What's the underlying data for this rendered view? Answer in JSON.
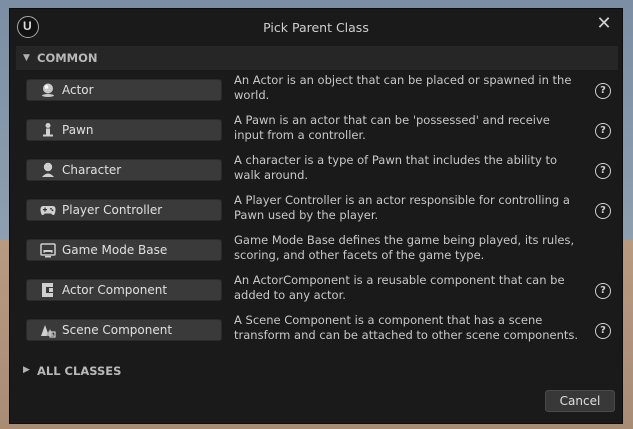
{
  "dialog": {
    "title": "Pick Parent Class",
    "close_icon": "close-icon"
  },
  "common": {
    "header": "COMMON",
    "items": [
      {
        "label": "Actor",
        "icon": "actor-icon",
        "description": "An Actor is an object that can be placed or spawned in the world.",
        "has_help": true
      },
      {
        "label": "Pawn",
        "icon": "pawn-icon",
        "description": "A Pawn is an actor that can be 'possessed' and receive input from a controller.",
        "has_help": true
      },
      {
        "label": "Character",
        "icon": "character-icon",
        "description": "A character is a type of Pawn that includes the ability to walk around.",
        "has_help": true
      },
      {
        "label": "Player Controller",
        "icon": "gamepad-icon",
        "description": "A Player Controller is an actor responsible for controlling a Pawn used by the player.",
        "has_help": true
      },
      {
        "label": "Game Mode Base",
        "icon": "game-mode-icon",
        "description": "Game Mode Base defines the game being played, its rules, scoring, and other facets of the game type.",
        "has_help": false
      },
      {
        "label": "Actor Component",
        "icon": "actor-component-icon",
        "description": "An ActorComponent is a reusable component that can be added to any actor.",
        "has_help": true
      },
      {
        "label": "Scene Component",
        "icon": "scene-component-icon",
        "description": "A Scene Component is a component that has a scene transform and can be attached to other scene components.",
        "has_help": true
      }
    ]
  },
  "all_classes": {
    "header": "ALL CLASSES"
  },
  "footer": {
    "cancel_label": "Cancel"
  }
}
